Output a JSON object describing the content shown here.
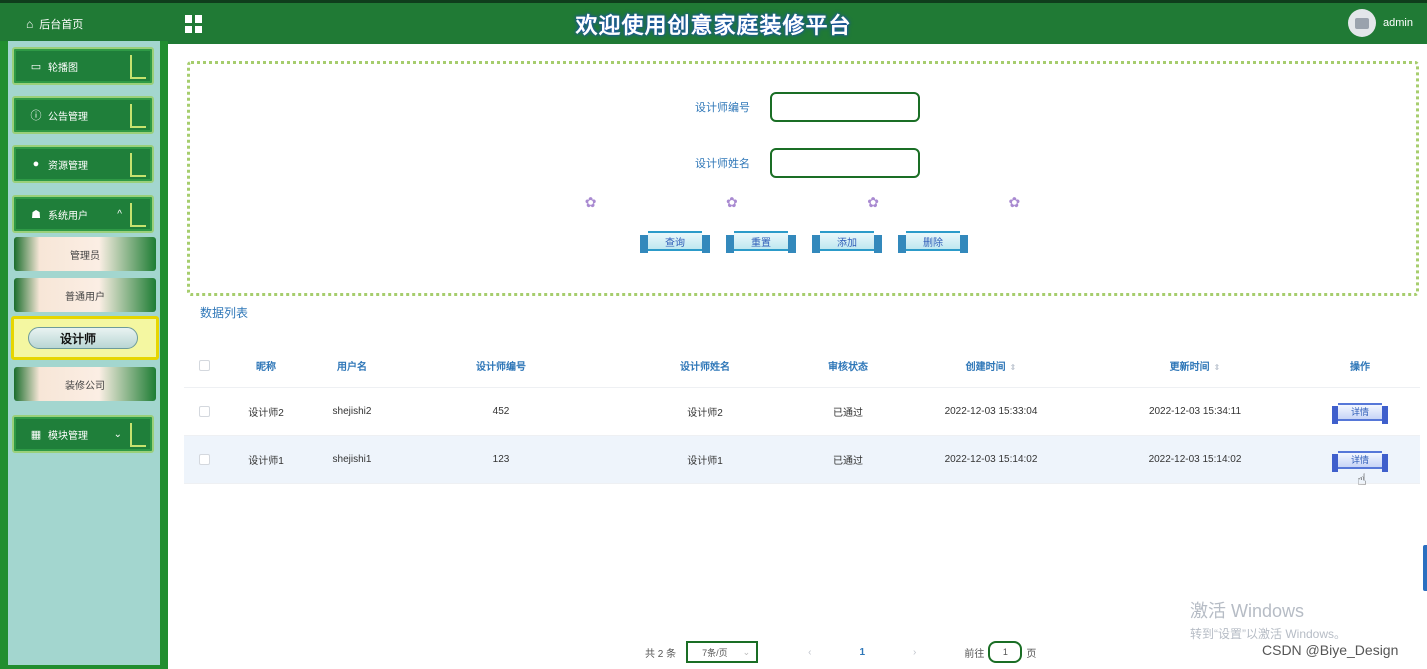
{
  "header": {
    "home_label": "后台首页",
    "title": "欢迎使用创意家庭装修平台",
    "user": "admin"
  },
  "sidebar": {
    "items": [
      {
        "label": "轮播图",
        "icon": "image-icon"
      },
      {
        "label": "公告管理",
        "icon": "info-icon"
      },
      {
        "label": "资源管理",
        "icon": "pin-icon"
      },
      {
        "label": "系统用户",
        "icon": "user-icon",
        "expanded": true
      },
      {
        "label": "模块管理",
        "icon": "grid-icon"
      }
    ],
    "sub_items": [
      {
        "label": "管理员"
      },
      {
        "label": "普通用户"
      },
      {
        "label": "设计师",
        "active": true
      },
      {
        "label": "装修公司"
      }
    ]
  },
  "search": {
    "field1_label": "设计师编号",
    "field1_value": "",
    "field2_label": "设计师姓名",
    "field2_value": "",
    "buttons": {
      "query": "查询",
      "reset": "重置",
      "add": "添加",
      "delete": "删除"
    }
  },
  "list_title": "数据列表",
  "table": {
    "headers": {
      "nickname": "昵称",
      "username": "用户名",
      "designer_no": "设计师编号",
      "designer_name": "设计师姓名",
      "review_status": "审核状态",
      "created": "创建时间",
      "updated": "更新时间",
      "op": "操作"
    },
    "rows": [
      {
        "nickname": "设计师2",
        "username": "shejishi2",
        "designer_no": "452",
        "designer_name": "设计师2",
        "review_status": "已通过",
        "created": "2022-12-03 15:33:04",
        "updated": "2022-12-03 15:34:11",
        "op": "详情"
      },
      {
        "nickname": "设计师1",
        "username": "shejishi1",
        "designer_no": "123",
        "designer_name": "设计师1",
        "review_status": "已通过",
        "created": "2022-12-03 15:14:02",
        "updated": "2022-12-03 15:14:02",
        "op": "详情"
      }
    ]
  },
  "pagination": {
    "total": "共 2 条",
    "page_size": "7条/页",
    "current_page": "1",
    "goto_prefix": "前往",
    "goto_value": "1",
    "goto_suffix": "页"
  },
  "watermark": {
    "line1": "激活 Windows",
    "line2": "转到“设置”以激活 Windows。"
  },
  "credit": "CSDN @Biye_Design",
  "colors": {
    "header_green": "#207a35",
    "sidebar_green": "#218e2f",
    "sidebar_panel": "#a3d6cf",
    "accent_blue": "#2f77b8",
    "active_yellow": "#f4f7a1"
  }
}
